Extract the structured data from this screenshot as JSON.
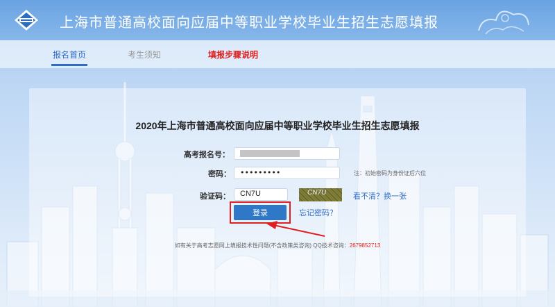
{
  "header": {
    "title": "上海市普通高校面向应届中等职业学校毕业生招生志愿填报",
    "logo_icon": "school-emblem-icon"
  },
  "nav": {
    "items": [
      {
        "label": "报名首页"
      },
      {
        "label": "考生须知"
      },
      {
        "label": "填报步骤说明"
      }
    ]
  },
  "form": {
    "title": "2020年上海市普通高校面向应届中等职业学校毕业生招生志愿填报",
    "exam_id_label": "高考报名号：",
    "password_label": "密码：",
    "password_value": "•••••••••",
    "password_hint": "注：初始密码为身份证后六位",
    "captcha_label": "验证码：",
    "captcha_value": "CN7U",
    "captcha_image_text": "CN7U",
    "refresh_label": "看不清？换一张",
    "login_label": "登录",
    "forgot_label": "忘记密码？"
  },
  "footer": {
    "text": "如有关于高考志愿网上填报技术性问题(不含政策类咨询)   QQ技术咨询：",
    "qq_number": "2679852713"
  },
  "colors": {
    "accent": "#2f6cc4",
    "highlight_red": "#e02020",
    "button_blue": "#2f78c8"
  }
}
